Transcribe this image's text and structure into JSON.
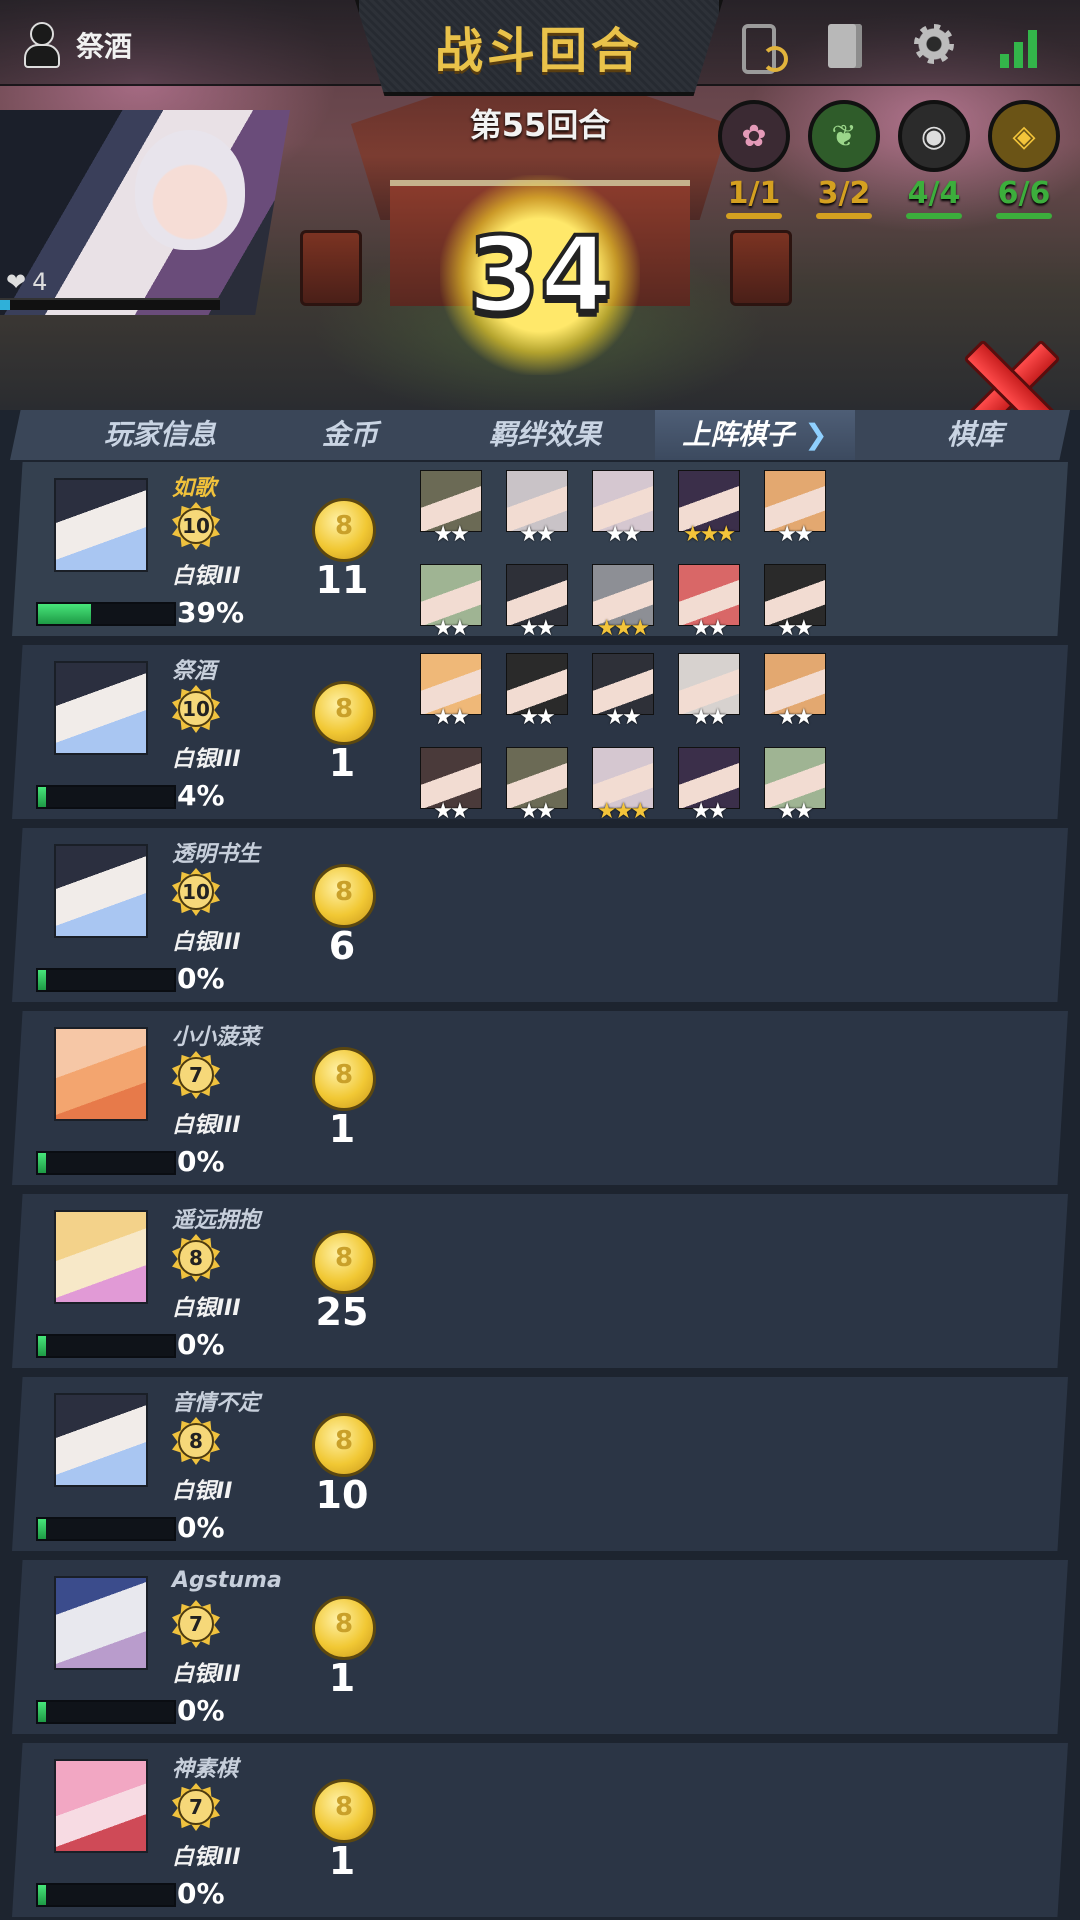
{
  "header": {
    "user_name": "祭酒",
    "title": "战斗回合",
    "round_label": "第55回合",
    "countdown": "34",
    "hp": "4",
    "icons": [
      "phone-sync-icon",
      "book-icon",
      "gear-icon",
      "signal-icon"
    ]
  },
  "traits": [
    {
      "icon": "sakura-icon",
      "count": "1/1",
      "color": "#d4a020"
    },
    {
      "icon": "leaf-icon",
      "count": "3/2",
      "color": "#d4a020"
    },
    {
      "icon": "eye-icon",
      "count": "4/4",
      "color": "#3cae3c"
    },
    {
      "icon": "ninja-icon",
      "count": "6/6",
      "color": "#3cae3c"
    }
  ],
  "tabs": [
    {
      "label": "玩家信息",
      "active": false
    },
    {
      "label": "金币",
      "active": false
    },
    {
      "label": "羁绊效果",
      "active": false
    },
    {
      "label": "上阵棋子",
      "active": true
    },
    {
      "label": "棋库",
      "active": false
    }
  ],
  "players": [
    {
      "name": "如歌",
      "level": "10",
      "rank": "白银III",
      "percent": "39%",
      "progress": 0.39,
      "gold": "11",
      "highlight": true
    },
    {
      "name": "祭酒",
      "level": "10",
      "rank": "白银III",
      "percent": "4%",
      "progress": 0.04,
      "gold": "1",
      "highlight": false
    },
    {
      "name": "透明书生",
      "level": "10",
      "rank": "白银III",
      "percent": "0%",
      "progress": 0.0,
      "gold": "6",
      "highlight": false
    },
    {
      "name": "小小菠菜",
      "level": "7",
      "rank": "白银III",
      "percent": "0%",
      "progress": 0.0,
      "gold": "1",
      "highlight": false
    },
    {
      "name": "遥远拥抱",
      "level": "8",
      "rank": "白银III",
      "percent": "0%",
      "progress": 0.0,
      "gold": "25",
      "highlight": false
    },
    {
      "name": "音情不定",
      "level": "8",
      "rank": "白银II",
      "percent": "0%",
      "progress": 0.0,
      "gold": "10",
      "highlight": false
    },
    {
      "name": "Agstuma",
      "level": "7",
      "rank": "白银III",
      "percent": "0%",
      "progress": 0.0,
      "gold": "1",
      "highlight": false
    },
    {
      "name": "神素棋",
      "level": "7",
      "rank": "白银III",
      "percent": "0%",
      "progress": 0.0,
      "gold": "1",
      "highlight": false
    }
  ],
  "deployed_units": [
    [
      {
        "stars": 2,
        "color": "#6b6a55"
      },
      {
        "stars": 2,
        "color": "#c9c3c7"
      },
      {
        "stars": 2,
        "color": "#d5c7d0"
      },
      {
        "stars": 3,
        "color": "#3b2f4a"
      },
      {
        "stars": 2,
        "color": "#e3a870"
      },
      {
        "stars": 2,
        "color": "#9fb493"
      },
      {
        "stars": 2,
        "color": "#2e3038"
      },
      {
        "stars": 3,
        "color": "#8d8f95"
      },
      {
        "stars": 2,
        "color": "#d96767"
      },
      {
        "stars": 2,
        "color": "#2a2a2a"
      }
    ],
    [
      {
        "stars": 2,
        "color": "#efb878"
      },
      {
        "stars": 2,
        "color": "#2a2a2a"
      },
      {
        "stars": 2,
        "color": "#2e3038"
      },
      {
        "stars": 2,
        "color": "#d7d2cf"
      },
      {
        "stars": 2,
        "color": "#e3a870"
      },
      {
        "stars": 2,
        "color": "#4a3a3a"
      },
      {
        "stars": 2,
        "color": "#6b6a55"
      },
      {
        "stars": 3,
        "color": "#d5c7d0"
      },
      {
        "stars": 2,
        "color": "#3b2f4a"
      },
      {
        "stars": 2,
        "color": "#9fb493"
      }
    ]
  ]
}
